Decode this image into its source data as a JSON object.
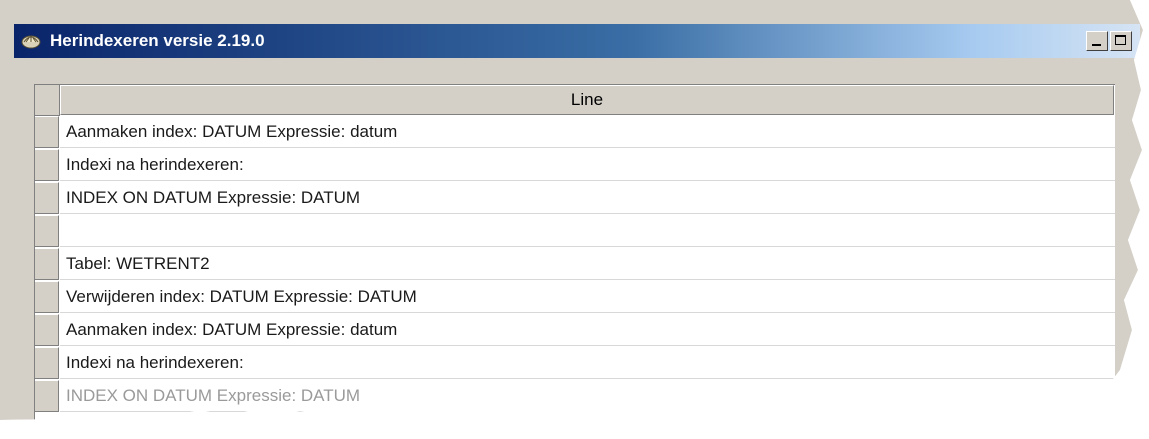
{
  "window": {
    "title": "Herindexeren versie 2.19.0",
    "title_icon": "app-icon"
  },
  "grid": {
    "columns": [
      "Line"
    ],
    "rows": [
      "Aanmaken index: DATUM Expressie: datum",
      "Indexi na herindexeren:",
      "INDEX ON DATUM Expressie: DATUM",
      "",
      "Tabel: WETRENT2",
      "Verwijderen index: DATUM Expressie: DATUM",
      "Aanmaken index: DATUM Expressie: datum",
      "Indexi na herindexeren:",
      "INDEX ON DATUM Expressie: DATUM"
    ]
  },
  "colors": {
    "titlebar_start": "#0a246a",
    "titlebar_end": "#a6caf0",
    "face": "#d4d0c8"
  }
}
